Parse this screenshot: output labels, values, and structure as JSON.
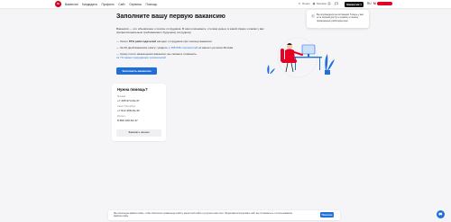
{
  "header": {
    "logo_text": "hh",
    "nav": [
      "Вакансии",
      "Кандидаты",
      "Профиль",
      "Сайт",
      "Сервисы",
      "Помощь"
    ],
    "search_label": "Поиск",
    "city_label": "Москва",
    "vacancy_button": "Вакансия",
    "lang": "RU",
    "user_label": "М"
  },
  "main": {
    "title": "Заполните вашу первую вакансию",
    "intro": "Вакансия — это объявление о поиске сотрудника. В нём описываете, кто вам нужен: в какой сфере и каким у вас профессиональным требованиям к будущему сотруднику",
    "bullet1_pre": "— Около ",
    "bullet1_bold": "87% работодателей",
    "bullet1_post": " находят сотрудника при помощи вакансии",
    "bullet2_pre": "— За 30 дней вакансию смогут увидеть ",
    "bullet2_link": "1 498 838 соискателей",
    "bullet2_post": " из вашего региона Москва",
    "bullet3_pre": "— Сразу после размещения вакансии, вы сможете позвонить",
    "bullet3_link": "из 70 самых подходящих соискателей",
    "cta": "Заполнить вакансию"
  },
  "help": {
    "title": "Нужна помощь?",
    "items": [
      {
        "label": "Москва",
        "value": "+7 495 974-64-37"
      },
      {
        "label": "Санкт-Петербург",
        "value": "+7 812 458-49-40"
      },
      {
        "label": "Россия",
        "value": "8 800 100-64-37"
      }
    ],
    "button": "Заказать звонок"
  },
  "tooltip": {
    "text": "Вы подтвердили регистрацию! Теперь у вас есть полный доступ к сервису и поиску проверенных работодателем",
    "icon": "info-icon"
  },
  "cookie": {
    "text": "Мы используем файлы cookie, чтобы обеспечить правильную работу нашего веб-сайта и улучшить ваш опыт. Продолжая использовать сайт, вы соглашаетесь с использованием файлов cookie.",
    "button": "Понятно"
  },
  "colors": {
    "brand": "#d6001c",
    "accent": "#1e6fd9"
  }
}
